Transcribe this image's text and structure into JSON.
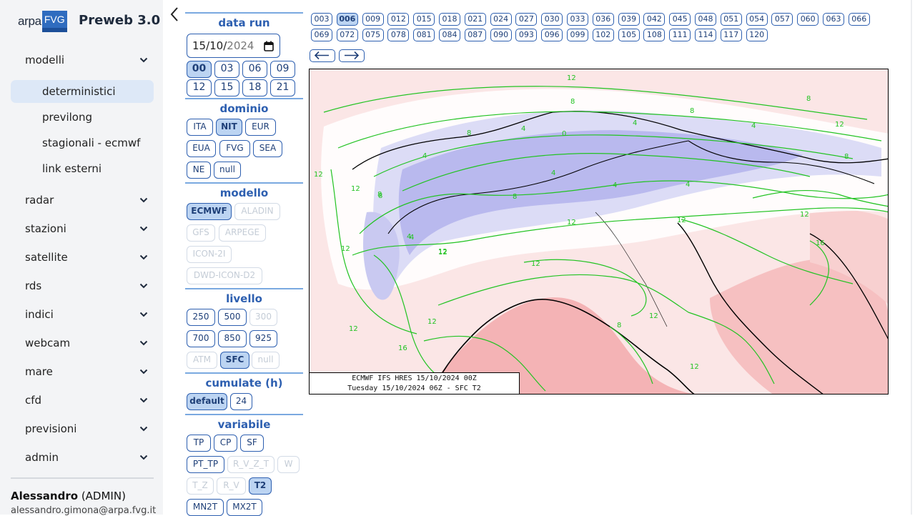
{
  "brand": {
    "logo_a": "arpa",
    "logo_b": "FVG",
    "title": "Preweb 3.0"
  },
  "sidebar": {
    "items": [
      {
        "label": "modelli",
        "expanded": true
      },
      {
        "label": "radar"
      },
      {
        "label": "stazioni"
      },
      {
        "label": "satellite"
      },
      {
        "label": "rds"
      },
      {
        "label": "indici"
      },
      {
        "label": "webcam"
      },
      {
        "label": "mare"
      },
      {
        "label": "cfd"
      },
      {
        "label": "previsioni"
      },
      {
        "label": "admin"
      }
    ],
    "subitems": [
      {
        "label": "deterministici",
        "active": true
      },
      {
        "label": "previlong"
      },
      {
        "label": "stagionali - ecmwf"
      },
      {
        "label": "link esterni"
      }
    ]
  },
  "user": {
    "name": "Alessandro",
    "role": "(ADMIN)",
    "email": "alessandro.gimona@arpa.fvg.it"
  },
  "panel": {
    "data_run": {
      "title": "data run",
      "date_dd": "15/10/",
      "date_yy": "2024",
      "hours": [
        "00",
        "03",
        "06",
        "09",
        "12",
        "15",
        "18",
        "21"
      ],
      "selected_hour": "00"
    },
    "dominio": {
      "title": "dominio",
      "options": [
        "ITA",
        "NIT",
        "EUR",
        "EUA",
        "FVG",
        "SEA",
        "NE",
        "null"
      ],
      "selected": "NIT"
    },
    "modello": {
      "title": "modello",
      "options": [
        "ECMWF",
        "ALADIN",
        "GFS",
        "ARPEGE",
        "ICON-2I",
        "DWD-ICON-D2"
      ],
      "selected": "ECMWF",
      "disabled": [
        "ALADIN",
        "GFS",
        "ARPEGE",
        "ICON-2I",
        "DWD-ICON-D2"
      ]
    },
    "livello": {
      "title": "livello",
      "options": [
        "250",
        "500",
        "300",
        "700",
        "850",
        "925",
        "ATM",
        "SFC",
        "null"
      ],
      "selected": "SFC",
      "disabled": [
        "300",
        "ATM",
        "null"
      ]
    },
    "cumulate": {
      "title": "cumulate (h)",
      "options": [
        "default",
        "24"
      ],
      "selected": "default"
    },
    "variabile": {
      "title": "variabile",
      "options": [
        "TP",
        "CP",
        "SF",
        "PT_TP",
        "R_V_Z_T",
        "W",
        "T_Z",
        "R_V",
        "T2",
        "MN2T",
        "MX2T"
      ],
      "selected": "T2",
      "disabled": [
        "R_V_Z_T",
        "W",
        "T_Z",
        "R_V"
      ]
    }
  },
  "forecast_hours": [
    "003",
    "006",
    "009",
    "012",
    "015",
    "018",
    "021",
    "024",
    "027",
    "030",
    "033",
    "036",
    "039",
    "042",
    "045",
    "048",
    "051",
    "054",
    "057",
    "060",
    "063",
    "066",
    "069",
    "072",
    "075",
    "078",
    "081",
    "084",
    "087",
    "090",
    "093",
    "096",
    "099",
    "102",
    "105",
    "108",
    "111",
    "114",
    "117",
    "120"
  ],
  "selected_forecast_hour": "006",
  "nav_arrows": {
    "prev": "←",
    "next": "→"
  },
  "map": {
    "caption_line1": "ECMWF IFS HRES 15/10/2024 00Z",
    "caption_line2": "Tuesday 15/10/2024 06Z - SFC T2",
    "contour_labels": [
      "12",
      "12",
      "8",
      "8",
      "8",
      "4",
      "4",
      "4",
      "4",
      "0",
      "8",
      "8",
      "8",
      "12",
      "12",
      "12",
      "4",
      "4",
      "4",
      "4",
      "8",
      "12",
      "12",
      "12",
      "12",
      "12",
      "12",
      "12",
      "16",
      "16",
      "12",
      "12",
      "8",
      "4",
      "12",
      "8"
    ],
    "colors": {
      "cold": "#b9b9ee",
      "cool": "#dcdcf6",
      "neutral": "#ffffff",
      "warm": "#fbe3e3",
      "hot": "#f4b3b5",
      "contour": "#22c322"
    }
  }
}
